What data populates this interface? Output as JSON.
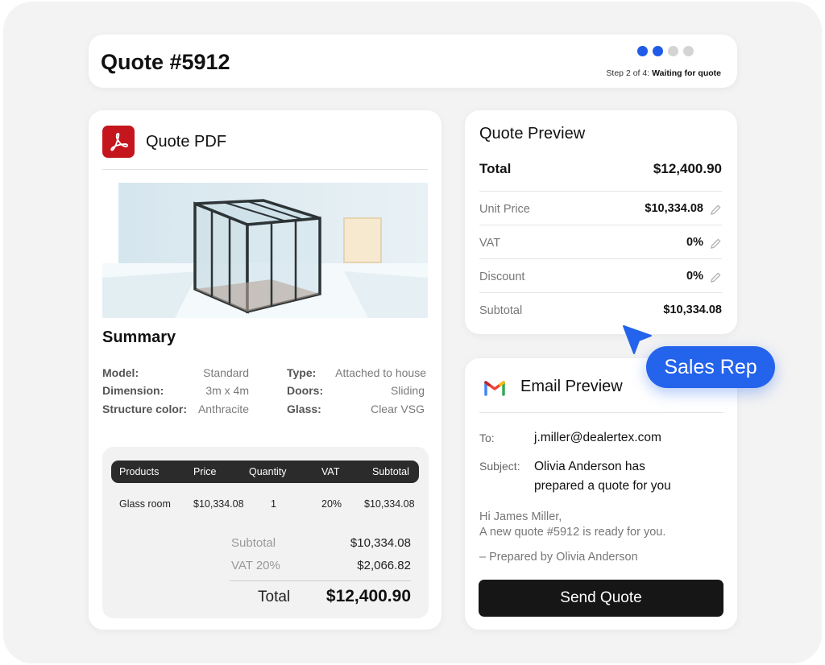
{
  "header": {
    "title": "Quote #5912",
    "step_prefix": "Step 2 of 4:",
    "step_status": "Waiting for quote",
    "total_steps": 4,
    "current_step": 2
  },
  "pdf_card": {
    "icon": "adobe-pdf-icon",
    "title": "Quote PDF",
    "summary_title": "Summary",
    "specs_left": [
      {
        "label": "Model:",
        "value": "Standard"
      },
      {
        "label": "Dimension:",
        "value": "3m x 4m"
      },
      {
        "label": "Structure color:",
        "value": "Anthracite"
      }
    ],
    "specs_right": [
      {
        "label": "Type:",
        "value": "Attached to house"
      },
      {
        "label": "Doors:",
        "value": "Sliding"
      },
      {
        "label": "Glass:",
        "value": "Clear VSG"
      }
    ],
    "table": {
      "headers": [
        "Products",
        "Price",
        "Quantity",
        "VAT",
        "Subtotal"
      ],
      "rows": [
        [
          "Glass room",
          "$10,334.08",
          "1",
          "20%",
          "$10,334.08"
        ]
      ]
    },
    "totals": {
      "subtotal_label": "Subtotal",
      "subtotal_value": "$10,334.08",
      "vat_label": "VAT 20%",
      "vat_value": "$2,066.82",
      "total_label": "Total",
      "total_value": "$12,400.90"
    }
  },
  "quote_preview": {
    "title": "Quote Preview",
    "total_label": "Total",
    "total_value": "$12,400.90",
    "rows": [
      {
        "label": "Unit Price",
        "value": "$10,334.08",
        "editable": true
      },
      {
        "label": "VAT",
        "value": "0%",
        "editable": true
      },
      {
        "label": "Discount",
        "value": "0%",
        "editable": true
      },
      {
        "label": "Subtotal",
        "value": "$10,334.08",
        "editable": false
      }
    ]
  },
  "email_preview": {
    "icon": "gmail-icon",
    "title": "Email Preview",
    "to_label": "To:",
    "to_value": "j.miller@dealertex.com",
    "subject_label": "Subject:",
    "subject_line1": "Olivia Anderson has",
    "subject_line2": "prepared a quote for you",
    "body_line1": "Hi James Miller,",
    "body_line2": "A new quote #5912 is ready for you.",
    "signature": "– Prepared by Olivia Anderson",
    "send_label": "Send Quote"
  },
  "badge": {
    "label": "Sales Rep"
  },
  "colors": {
    "accent": "#2463eb",
    "step_active": "#1f5be6",
    "pdf_red": "#c4161c",
    "button_dark": "#161616"
  }
}
